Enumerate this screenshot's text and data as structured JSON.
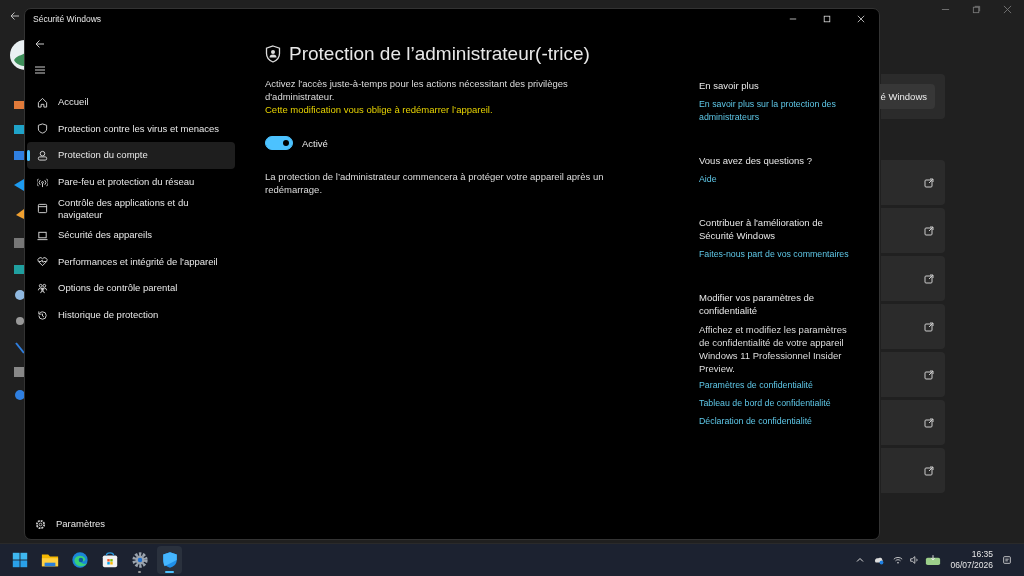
{
  "background_window": {
    "button": "é Windows"
  },
  "window": {
    "title": "Sécurité Windows"
  },
  "sidebar": {
    "items": [
      {
        "label": "Accueil",
        "kind": "home",
        "selected": false
      },
      {
        "label": "Protection contre les virus et menaces",
        "kind": "shield",
        "selected": false
      },
      {
        "label": "Protection du compte",
        "kind": "person",
        "selected": true
      },
      {
        "label": "Pare-feu et protection du réseau",
        "kind": "antenna",
        "selected": false
      },
      {
        "label": "Contrôle des applications et du navigateur",
        "kind": "browser",
        "selected": false
      },
      {
        "label": "Sécurité des appareils",
        "kind": "laptop",
        "selected": false
      },
      {
        "label": "Performances et intégrité de l'appareil",
        "kind": "heart",
        "selected": false
      },
      {
        "label": "Options de contrôle parental",
        "kind": "family",
        "selected": false
      },
      {
        "label": "Historique de protection",
        "kind": "history",
        "selected": false
      }
    ],
    "footer": {
      "label": "Paramètres"
    }
  },
  "page": {
    "title": "Protection de l’administrateur(-trice)",
    "description": "Activez l'accès juste-à-temps pour les actions nécessitant des privilèges d'administrateur.",
    "warning": "Cette modification vous oblige à redémarrer l’appareil.",
    "toggle": {
      "on": true,
      "label": "Activé"
    },
    "note": "La protection de l’administrateur commencera à protéger votre appareil après un redémarrage."
  },
  "aside": {
    "sections": [
      {
        "heading": "En savoir plus",
        "links": [
          "En savoir plus sur la protection des administrateurs"
        ]
      },
      {
        "heading": "Vous avez des questions ?",
        "links": [
          "Aide"
        ]
      },
      {
        "heading": "Contribuer à l'amélioration de Sécurité Windows",
        "links": [
          "Faites-nous part de vos commentaires"
        ]
      },
      {
        "heading": "Modifier vos paramètres de confidentialité",
        "text": "Affichez et modifiez les paramètres de confidentialité de votre appareil Windows 11 Professionnel Insider Preview.",
        "links": [
          "Paramètres de confidentialité",
          "Tableau de bord de confidentialité",
          "Déclaration de confidentialité"
        ]
      }
    ]
  },
  "taskbar": {
    "apps": [
      {
        "kind": "start",
        "open": false,
        "selected": false
      },
      {
        "kind": "folder",
        "open": false,
        "selected": false
      },
      {
        "kind": "browser",
        "open": false,
        "selected": false
      },
      {
        "kind": "store",
        "open": false,
        "selected": false
      },
      {
        "kind": "settings",
        "open": true,
        "selected": false
      },
      {
        "kind": "security",
        "open": true,
        "selected": true
      }
    ],
    "time": "16:35",
    "date": "06/07/2026"
  }
}
